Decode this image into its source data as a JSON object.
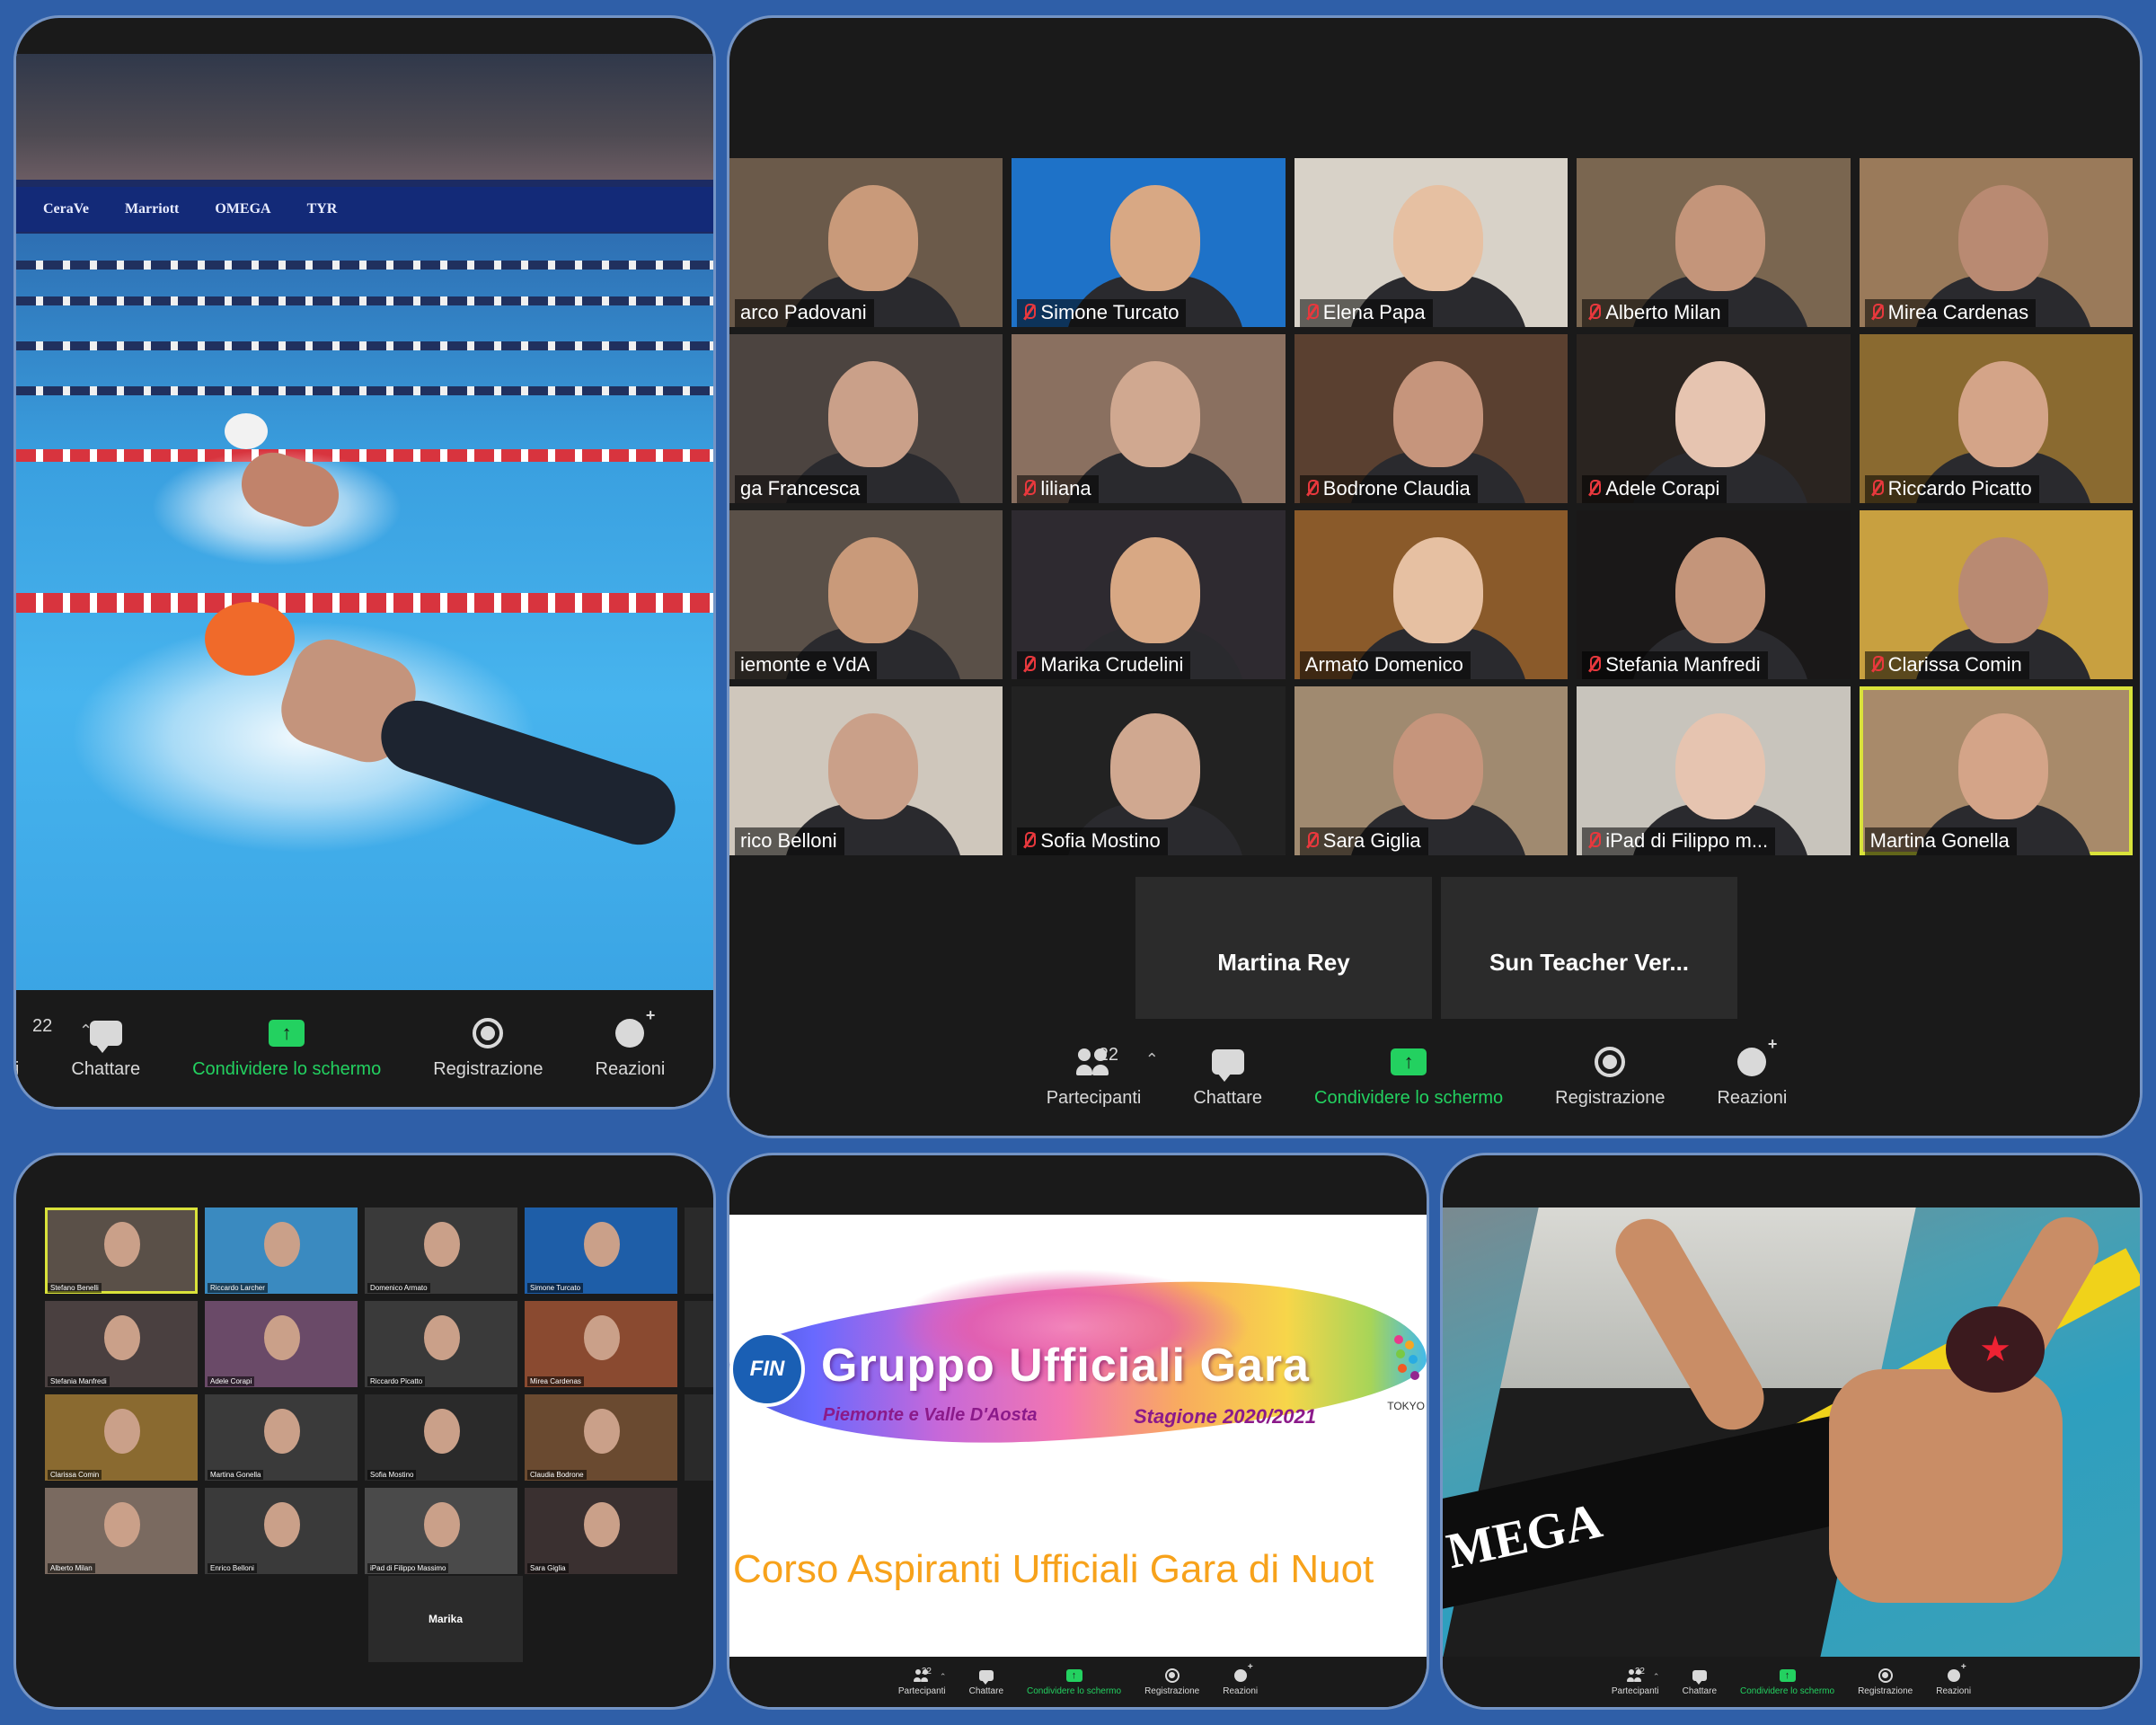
{
  "colors": {
    "background": "#2f5fa8",
    "zoom_dark": "#1a1a1a",
    "share_green": "#23d160",
    "mute_red": "#e8383d",
    "active_speaker": "#d9e23a",
    "slide_orange": "#f7a21b"
  },
  "toolbar": {
    "participants_count": "22",
    "participants_label": "Partecipanti",
    "participants_label_cropped": "panti",
    "chat_label": "Chattare",
    "share_label": "Condividere lo schermo",
    "record_label": "Registrazione",
    "reactions_label": "Reazioni",
    "icons": [
      "participants-icon",
      "chat-icon",
      "share-screen-icon",
      "record-icon",
      "reactions-icon"
    ]
  },
  "swim_panel": {
    "banner_logos": [
      "CeraVe",
      "Marriott",
      "OMEGA",
      "TYR"
    ]
  },
  "gallery": {
    "tiles": [
      {
        "name": "arco Padovani",
        "muted": false
      },
      {
        "name": "Simone Turcato",
        "muted": true
      },
      {
        "name": "Elena Papa",
        "muted": true
      },
      {
        "name": "Alberto Milan",
        "muted": true
      },
      {
        "name": "Mirea Cardenas",
        "muted": true
      },
      {
        "name": "ga Francesca",
        "muted": false
      },
      {
        "name": "liliana",
        "muted": true
      },
      {
        "name": "Bodrone Claudia",
        "muted": true
      },
      {
        "name": "Adele Corapi",
        "muted": true
      },
      {
        "name": "Riccardo Picatto",
        "muted": true
      },
      {
        "name": "iemonte e VdA",
        "muted": false
      },
      {
        "name": "Marika Crudelini",
        "muted": true
      },
      {
        "name": "Armato Domenico",
        "muted": false
      },
      {
        "name": "Stefania Manfredi",
        "muted": true
      },
      {
        "name": "Clarissa Comin",
        "muted": true
      },
      {
        "name": "rico Belloni",
        "muted": false
      },
      {
        "name": "Sofia Mostino",
        "muted": true
      },
      {
        "name": "Sara Giglia",
        "muted": true
      },
      {
        "name": "iPad di Filippo m...",
        "muted": true
      },
      {
        "name": "Martina Gonella",
        "muted": false
      }
    ],
    "no_video": [
      {
        "name": "Martina Rey"
      },
      {
        "name": "Sun Teacher Ver..."
      }
    ]
  },
  "small_gallery": {
    "tiles": [
      {
        "name": "Stefano Benelli"
      },
      {
        "name": "Riccardo Larcher"
      },
      {
        "name": "Domenico Armato"
      },
      {
        "name": "Simone Turcato"
      },
      {
        "name": ""
      },
      {
        "name": "Stefania Manfredi"
      },
      {
        "name": "Adele Corapi"
      },
      {
        "name": "Riccardo Picatto"
      },
      {
        "name": "Mirea Cardenas"
      },
      {
        "name": ""
      },
      {
        "name": "Clarissa Comin"
      },
      {
        "name": "Martina Gonella"
      },
      {
        "name": "Sofia Mostino"
      },
      {
        "name": "Claudia Bodrone"
      },
      {
        "name": ""
      },
      {
        "name": "Alberto Milan"
      },
      {
        "name": "Enrico Belloni"
      },
      {
        "name": "iPad di Filippo Massimo"
      },
      {
        "name": "Sara Giglia"
      }
    ],
    "no_video": "Marika"
  },
  "slide": {
    "logo_text": "FIN",
    "title": "Gruppo Ufficiali Gara",
    "region": "Piemonte e Valle D'Aosta",
    "season": "Stagione 2020/2021",
    "tokyo_label": "TOKYO",
    "course_title": "Corso Aspiranti Ufficiali Gara di Nuot"
  },
  "swim2_panel": {
    "wall_brand": "MEGA",
    "cap_symbol": "★"
  }
}
